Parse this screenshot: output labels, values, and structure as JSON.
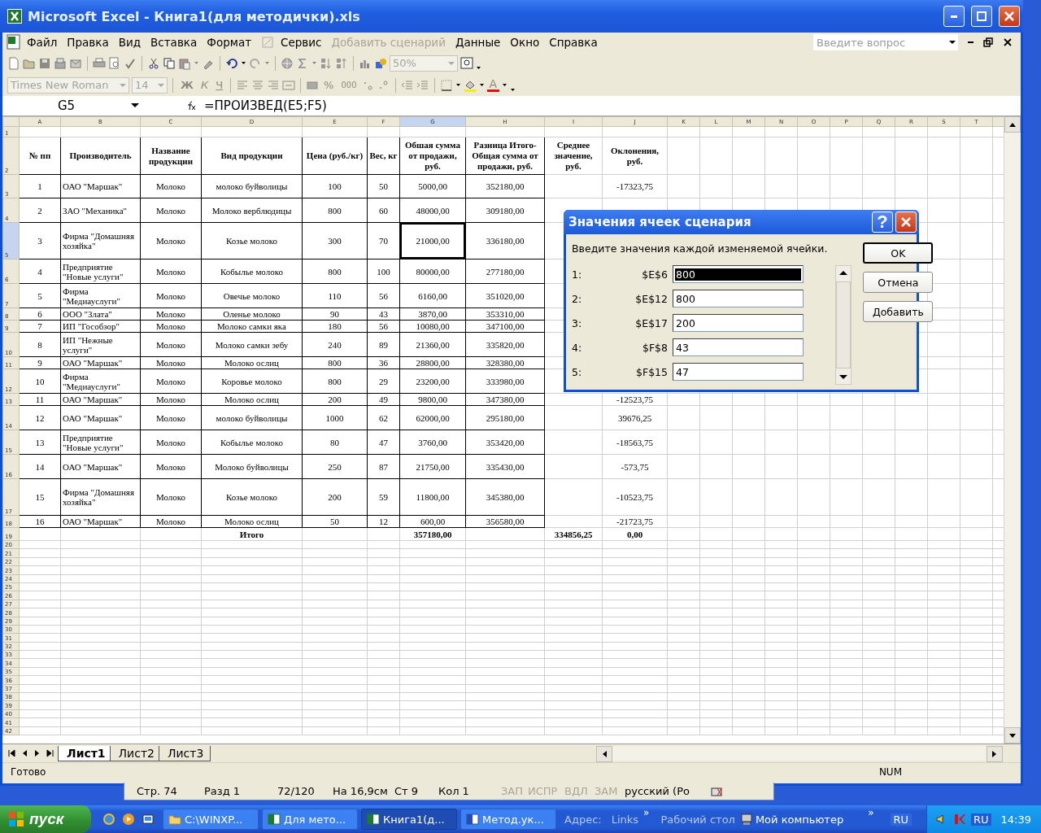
{
  "window": {
    "title": "Microsoft Excel - Книга1(для методички).xls"
  },
  "menu": [
    {
      "label": "Файл",
      "disabled": false,
      "icon_before": false
    },
    {
      "label": "Правка",
      "disabled": false,
      "icon_before": false
    },
    {
      "label": "Вид",
      "disabled": false,
      "icon_before": false
    },
    {
      "label": "Вставка",
      "disabled": false,
      "icon_before": false
    },
    {
      "label": "Формат",
      "disabled": false,
      "icon_before": false
    },
    {
      "label": "Сервис",
      "disabled": false,
      "icon_before": true
    },
    {
      "label": "Добавить сценарий",
      "disabled": true,
      "icon_before": false
    },
    {
      "label": "Данные",
      "disabled": false,
      "icon_before": false
    },
    {
      "label": "Окно",
      "disabled": false,
      "icon_before": false
    },
    {
      "label": "Справка",
      "disabled": false,
      "icon_before": false
    }
  ],
  "help_box": {
    "placeholder": "Введите вопрос"
  },
  "standard_toolbar": {
    "zoom": "50%"
  },
  "formatting_toolbar": {
    "font": "Times New Roman",
    "size": "14",
    "bold": "Ж",
    "italic": "К",
    "underline": "Ч",
    "percent": "%",
    "thousands": "000",
    "font_color": "A"
  },
  "formula_bar": {
    "name_box": "G5",
    "formula": "=ПРОИЗВЕД(E5;F5)"
  },
  "sheet": {
    "columns": [
      {
        "label": "A",
        "selected": false
      },
      {
        "label": "B",
        "selected": false
      },
      {
        "label": "C",
        "selected": false
      },
      {
        "label": "D",
        "selected": false
      },
      {
        "label": "E",
        "selected": false
      },
      {
        "label": "F",
        "selected": false
      },
      {
        "label": "G",
        "selected": true
      },
      {
        "label": "H",
        "selected": false
      },
      {
        "label": "I",
        "selected": false
      },
      {
        "label": "J",
        "selected": false
      },
      {
        "label": "K",
        "selected": false
      },
      {
        "label": "L",
        "selected": false
      },
      {
        "label": "M",
        "selected": false
      },
      {
        "label": "N",
        "selected": false
      },
      {
        "label": "O",
        "selected": false
      },
      {
        "label": "P",
        "selected": false
      },
      {
        "label": "Q",
        "selected": false
      },
      {
        "label": "R",
        "selected": false
      },
      {
        "label": "S",
        "selected": false
      },
      {
        "label": "T",
        "selected": false
      }
    ],
    "rows": [
      {
        "number": "1",
        "selected": false,
        "kind": "empty"
      },
      {
        "number": "2",
        "selected": false,
        "kind": "header",
        "cells": {
          "A": "№ пп",
          "B": "Производитель",
          "C": "Название продукции",
          "D": "Вид продукции",
          "E": "Цена (руб./кг)",
          "F": "Вес, кг",
          "G": "Обшая сумма от продажи, руб.",
          "H": "Разница Итого-Общая сумма от продажи, руб.",
          "I": "Среднее значение, руб.",
          "J": "Оклонения, руб."
        }
      },
      {
        "number": "3",
        "selected": false,
        "kind": "data",
        "cells": {
          "A": "1",
          "B": "ОАО \"Маршак\"",
          "C": "Молоко",
          "D": "молоко буйволицы",
          "E": "100",
          "F": "50",
          "G": "5000,00",
          "H": "352180,00",
          "J": "-17323,75"
        }
      },
      {
        "number": "4",
        "selected": false,
        "kind": "data",
        "cells": {
          "A": "2",
          "B": "ЗАО \"Механика\"",
          "C": "Молоко",
          "D": "Молоко верблюдицы",
          "E": "800",
          "F": "60",
          "G": "48000,00",
          "H": "309180,00"
        }
      },
      {
        "number": "5",
        "selected": true,
        "kind": "data",
        "cells": {
          "A": "3",
          "B": "Фирма \"Домашняя хозяйка\"",
          "C": "Молоко",
          "D": "Козье молоко",
          "E": "300",
          "F": "70",
          "G": "21000,00",
          "H": "336180,00"
        }
      },
      {
        "number": "6",
        "selected": false,
        "kind": "data",
        "cells": {
          "A": "4",
          "B": "Предприятие \"Новые услуги\"",
          "C": "Молоко",
          "D": "Кобылье молоко",
          "E": "800",
          "F": "100",
          "G": "80000,00",
          "H": "277180,00"
        }
      },
      {
        "number": "7",
        "selected": false,
        "kind": "data",
        "cells": {
          "A": "5",
          "B": "Фирма \"Медиауслуги\"",
          "C": "Молоко",
          "D": "Овечье молоко",
          "E": "110",
          "F": "56",
          "G": "6160,00",
          "H": "351020,00"
        }
      },
      {
        "number": "8",
        "selected": false,
        "kind": "data",
        "cells": {
          "A": "6",
          "B": "ООО \"Злата\"",
          "C": "Молоко",
          "D": "Оленье молоко",
          "E": "90",
          "F": "43",
          "G": "3870,00",
          "H": "353310,00"
        }
      },
      {
        "number": "9",
        "selected": false,
        "kind": "data",
        "cells": {
          "A": "7",
          "B": "ИП \"Гособзор\"",
          "C": "Молоко",
          "D": "Молоко самки яка",
          "E": "180",
          "F": "56",
          "G": "10080,00",
          "H": "347100,00"
        }
      },
      {
        "number": "10",
        "selected": false,
        "kind": "data",
        "cells": {
          "A": "8",
          "B": "ИП \"Нежные услуги\"",
          "C": "Молоко",
          "D": "Молоко самки зебу",
          "E": "240",
          "F": "89",
          "G": "21360,00",
          "H": "335820,00"
        }
      },
      {
        "number": "11",
        "selected": false,
        "kind": "data",
        "cells": {
          "A": "9",
          "B": "ОАО \"Маршак\"",
          "C": "Молоко",
          "D": "Молоко ослиц",
          "E": "800",
          "F": "36",
          "G": "28800,00",
          "H": "328380,00"
        }
      },
      {
        "number": "12",
        "selected": false,
        "kind": "data",
        "cells": {
          "A": "10",
          "B": "Фирма \"Медиауслуги\"",
          "C": "Молоко",
          "D": "Коровье молоко",
          "E": "800",
          "F": "29",
          "G": "23200,00",
          "H": "333980,00"
        }
      },
      {
        "number": "13",
        "selected": false,
        "kind": "data",
        "cells": {
          "A": "11",
          "B": "ОАО \"Маршак\"",
          "C": "Молоко",
          "D": "Молоко ослиц",
          "E": "200",
          "F": "49",
          "G": "9800,00",
          "H": "347380,00",
          "J": "-12523,75"
        }
      },
      {
        "number": "14",
        "selected": false,
        "kind": "data",
        "cells": {
          "A": "12",
          "B": "ОАО \"Маршак\"",
          "C": "Молоко",
          "D": "молоко буйволицы",
          "E": "1000",
          "F": "62",
          "G": "62000,00",
          "H": "295180,00",
          "J": "39676,25"
        }
      },
      {
        "number": "15",
        "selected": false,
        "kind": "data",
        "cells": {
          "A": "13",
          "B": "Предприятие \"Новые услуги\"",
          "C": "Молоко",
          "D": "Кобылье молоко",
          "E": "80",
          "F": "47",
          "G": "3760,00",
          "H": "353420,00",
          "J": "-18563,75"
        }
      },
      {
        "number": "16",
        "selected": false,
        "kind": "data",
        "cells": {
          "A": "14",
          "B": "ОАО \"Маршак\"",
          "C": "Молоко",
          "D": "Молоко буйволицы",
          "E": "250",
          "F": "87",
          "G": "21750,00",
          "H": "335430,00",
          "J": "-573,75"
        }
      },
      {
        "number": "17",
        "selected": false,
        "kind": "data",
        "cells": {
          "A": "15",
          "B": "Фирма \"Домашняя хозяйка\"",
          "C": "Молоко",
          "D": "Козье молоко",
          "E": "200",
          "F": "59",
          "G": "11800,00",
          "H": "345380,00",
          "J": "-10523,75"
        }
      },
      {
        "number": "18",
        "selected": false,
        "kind": "data",
        "cells": {
          "A": "16",
          "B": "ОАО \"Маршак\"",
          "C": "Молоко",
          "D": "Молоко ослиц",
          "E": "50",
          "F": "12",
          "G": "600,00",
          "H": "356580,00",
          "J": "-21723,75"
        }
      },
      {
        "number": "19",
        "selected": false,
        "kind": "total",
        "cells": {
          "D": "Итого",
          "G": "357180,00",
          "I": "334856,25",
          "J": "0,00"
        }
      },
      {
        "number": "20",
        "selected": false,
        "kind": "empty"
      },
      {
        "number": "21",
        "selected": false,
        "kind": "empty"
      },
      {
        "number": "22",
        "selected": false,
        "kind": "empty"
      },
      {
        "number": "23",
        "selected": false,
        "kind": "empty"
      },
      {
        "number": "24",
        "selected": false,
        "kind": "empty"
      },
      {
        "number": "25",
        "selected": false,
        "kind": "empty"
      },
      {
        "number": "26",
        "selected": false,
        "kind": "empty"
      },
      {
        "number": "27",
        "selected": false,
        "kind": "empty"
      },
      {
        "number": "28",
        "selected": false,
        "kind": "empty"
      },
      {
        "number": "29",
        "selected": false,
        "kind": "empty"
      },
      {
        "number": "30",
        "selected": false,
        "kind": "empty"
      },
      {
        "number": "31",
        "selected": false,
        "kind": "empty"
      },
      {
        "number": "32",
        "selected": false,
        "kind": "empty"
      },
      {
        "number": "33",
        "selected": false,
        "kind": "empty"
      },
      {
        "number": "34",
        "selected": false,
        "kind": "empty"
      },
      {
        "number": "35",
        "selected": false,
        "kind": "empty"
      },
      {
        "number": "36",
        "selected": false,
        "kind": "empty"
      },
      {
        "number": "37",
        "selected": false,
        "kind": "empty"
      },
      {
        "number": "38",
        "selected": false,
        "kind": "empty"
      },
      {
        "number": "39",
        "selected": false,
        "kind": "empty"
      },
      {
        "number": "40",
        "selected": false,
        "kind": "empty"
      },
      {
        "number": "41",
        "selected": false,
        "kind": "empty"
      },
      {
        "number": "42",
        "selected": false,
        "kind": "empty"
      }
    ]
  },
  "dialog": {
    "title": "Значения ячеек сценария",
    "help_button": "?",
    "prompt": "Введите значения каждой изменяемой ячейки.",
    "fields": [
      {
        "number": "1:",
        "ref": "$E$6",
        "value": "800",
        "selected": true
      },
      {
        "number": "2:",
        "ref": "$E$12",
        "value": "800",
        "selected": false
      },
      {
        "number": "3:",
        "ref": "$E$17",
        "value": "200",
        "selected": false
      },
      {
        "number": "4:",
        "ref": "$F$8",
        "value": "43",
        "selected": false
      },
      {
        "number": "5:",
        "ref": "$F$15",
        "value": "47",
        "selected": false
      }
    ],
    "buttons": [
      {
        "label": "OK",
        "default": true
      },
      {
        "label": "Отмена",
        "default": false
      },
      {
        "label": "Добавить",
        "default": false
      }
    ]
  },
  "sheet_tabs": [
    {
      "label": "Лист1",
      "selected": true
    },
    {
      "label": "Лист2",
      "selected": false
    },
    {
      "label": "Лист3",
      "selected": false
    }
  ],
  "status_bar": {
    "text": "Готово",
    "indicator": "NUM"
  },
  "word_status_bar": [
    {
      "label": "Стр. 74",
      "disabled": false
    },
    {
      "label": "Разд 1",
      "disabled": false
    },
    {
      "label": "72/120",
      "disabled": false
    },
    {
      "label": "На 16,9см",
      "disabled": false
    },
    {
      "label": "Ст 9",
      "disabled": false
    },
    {
      "label": "Кол 1",
      "disabled": false
    },
    {
      "label": "ЗАП",
      "disabled": true
    },
    {
      "label": "ИСПР",
      "disabled": true
    },
    {
      "label": "ВДЛ",
      "disabled": true
    },
    {
      "label": "ЗАМ",
      "disabled": true
    },
    {
      "label": "русский (Ро",
      "disabled": false
    }
  ],
  "taskbar": {
    "start": "пуск",
    "tasks": [
      {
        "label": "C:\\WINXP...",
        "kind": "folder",
        "selected": false
      },
      {
        "label": "Для мето...",
        "kind": "excel",
        "selected": false
      },
      {
        "label": "Книга1(д...",
        "kind": "excel",
        "selected": true
      },
      {
        "label": "Метод.ук...",
        "kind": "word",
        "selected": false
      }
    ],
    "address_label": "Адрес:",
    "links": "Links",
    "chevron_1": "»",
    "desktop": "Рабочий стол",
    "my_computer": "Мой компьютер",
    "chevron_2": "»",
    "language": "RU",
    "tray_language": "RU",
    "clock": "14:39"
  }
}
